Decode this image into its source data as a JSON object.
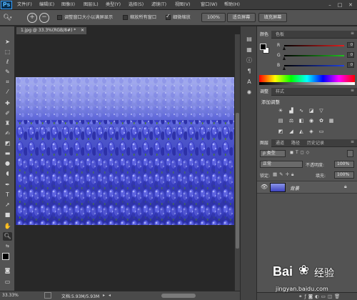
{
  "app": {
    "logo": "Ps",
    "menus": [
      "文件(F)",
      "编辑(E)",
      "图像(I)",
      "图层(L)",
      "类型(Y)",
      "选择(S)",
      "滤镜(T)",
      "视图(V)",
      "窗口(W)",
      "帮助(H)"
    ]
  },
  "options_bar": {
    "resize_windows_label": "调整窗口大小以满屏显示",
    "zoom_all_windows_label": "缩放所有窗口",
    "scrubby_zoom_label": "细微缩放",
    "resize_windows_checked": false,
    "zoom_all_windows_checked": false,
    "scrubby_zoom_checked": true,
    "btn_100": "100%",
    "btn_fit": "适合屏幕",
    "btn_fill": "填充屏幕"
  },
  "document": {
    "tab_title": "1.jpg @ 33.3%(RGB/8#) *",
    "zoom": "33.33%",
    "doc_info": "文档:5.93M/5.93M"
  },
  "color_panel": {
    "tabs": [
      "颜色",
      "色板"
    ],
    "channels": [
      {
        "label": "R",
        "color": "#e02020",
        "value": 0
      },
      {
        "label": "G",
        "color": "#20c020",
        "value": 0
      },
      {
        "label": "B",
        "color": "#2040e0",
        "value": 0
      }
    ]
  },
  "adjustments_panel": {
    "tabs": [
      "调整",
      "样式"
    ],
    "heading": "添加调整"
  },
  "layers_panel": {
    "tabs": [
      "图层",
      "通道",
      "路径",
      "历史记录"
    ],
    "kind_filter": "ρ 类型",
    "blend_mode": "正常",
    "opacity_label": "不透明度:",
    "opacity_value": "100%",
    "lock_label": "锁定:",
    "fill_label": "填充:",
    "fill_value": "100%",
    "layers": [
      {
        "name": "背景",
        "locked": true,
        "visible": true
      }
    ]
  },
  "watermark": {
    "brand": "Bai",
    "brand_suffix": "经验",
    "url": "jingyan.baidu.com"
  }
}
